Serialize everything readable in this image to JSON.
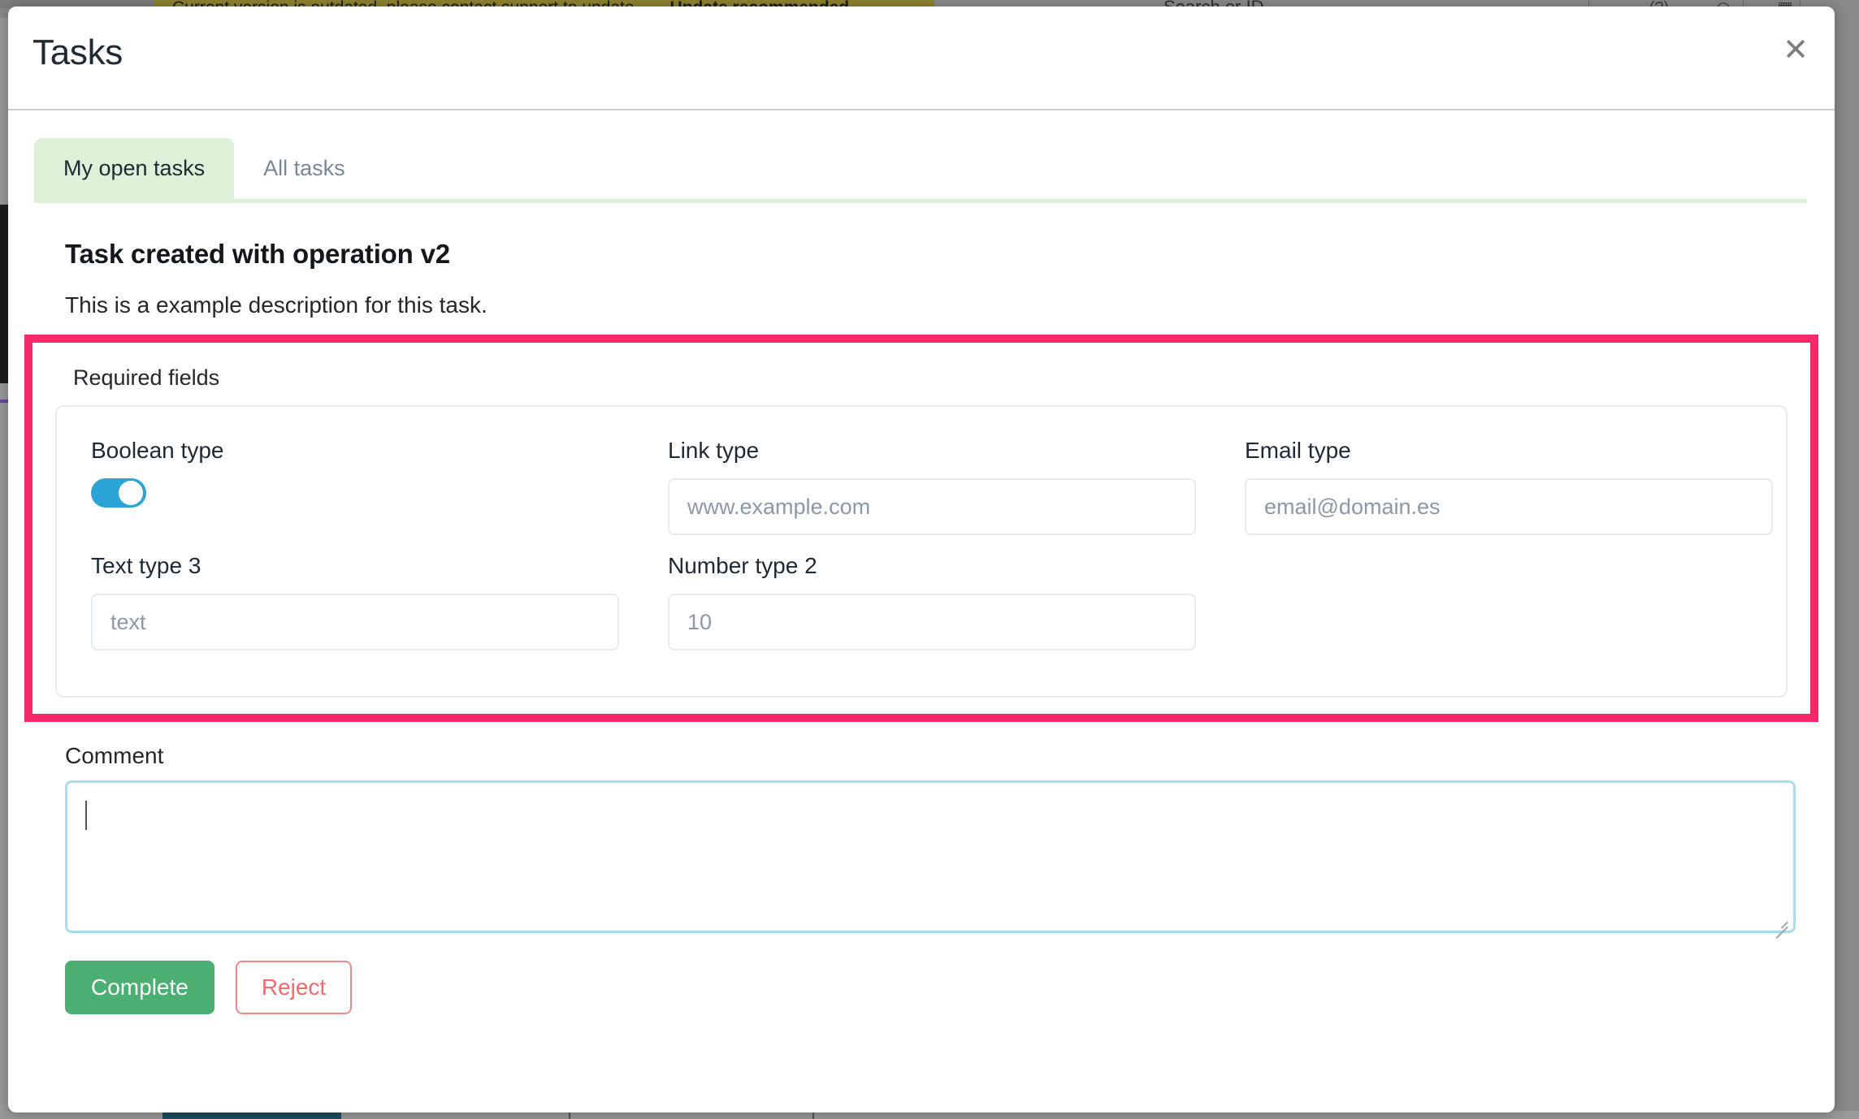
{
  "background": {
    "banner_text": "Current version is outdated, please contact support to update",
    "banner_action": "Update recommended",
    "search_placeholder": "Search or ID",
    "icons": [
      "chevron-down",
      "(?)",
      "bell",
      "grid"
    ]
  },
  "modal": {
    "title": "Tasks",
    "close_label": "✕"
  },
  "tabs": [
    {
      "label": "My open tasks",
      "active": true
    },
    {
      "label": "All tasks",
      "active": false
    }
  ],
  "task": {
    "title": "Task created with operation v2",
    "description": "This is a example description for this task."
  },
  "required_fields": {
    "section_label": "Required fields",
    "highlight_color": "#f6286a",
    "rows": [
      [
        {
          "label": "Boolean type",
          "type": "toggle",
          "value": "on",
          "accent": "#2ba3d6"
        },
        {
          "label": "Link type",
          "type": "text",
          "value": "",
          "placeholder": "www.example.com"
        },
        {
          "label": "Email type",
          "type": "text",
          "value": "",
          "placeholder": "email@domain.es"
        }
      ],
      [
        {
          "label": "Text type 3",
          "type": "text",
          "value": "",
          "placeholder": "text"
        },
        {
          "label": "Number type 2",
          "type": "text",
          "value": "",
          "placeholder": "10"
        }
      ]
    ]
  },
  "comment": {
    "label": "Comment",
    "value": "",
    "placeholder": "",
    "focused": true,
    "focus_color": "#a9dcef"
  },
  "actions": {
    "complete_label": "Complete",
    "complete_color": "#4caf72",
    "reject_label": "Reject",
    "reject_color": "#ef6c6c"
  }
}
